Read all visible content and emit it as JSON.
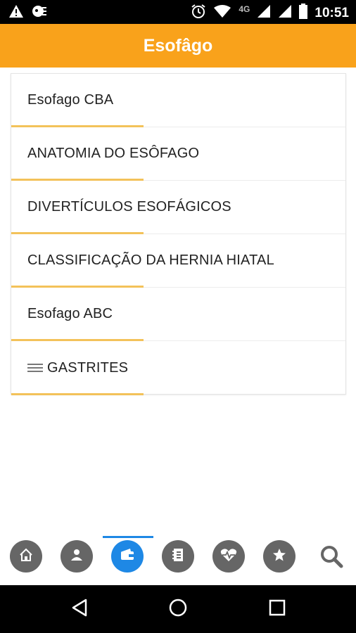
{
  "status_bar": {
    "time": "10:51",
    "network": "4G",
    "icons": [
      "warning-icon",
      "notification-icon",
      "alarm-icon",
      "wifi-icon",
      "signal-icon",
      "battery-icon"
    ]
  },
  "app_bar": {
    "title": "Esofâgo"
  },
  "list": {
    "items": [
      {
        "label": "Esofago CBA",
        "icon": null
      },
      {
        "label": "ANATOMIA DO ESÔFAGO",
        "icon": null
      },
      {
        "label": "DIVERTÍCULOS ESOFÁGICOS",
        "icon": null
      },
      {
        "label": "CLASSIFICAÇÃO DA HERNIA HIATAL",
        "icon": null
      },
      {
        "label": "Esofago ABC",
        "icon": null
      },
      {
        "label": "GASTRITES",
        "icon": "menu-lines-icon"
      }
    ]
  },
  "bottom_nav": {
    "items": [
      {
        "name": "home",
        "icon": "home-icon",
        "active": false
      },
      {
        "name": "profile",
        "icon": "person-icon",
        "active": false
      },
      {
        "name": "wallet",
        "icon": "wallet-icon",
        "active": true
      },
      {
        "name": "notes",
        "icon": "notebook-icon",
        "active": false
      },
      {
        "name": "health",
        "icon": "heartbeat-icon",
        "active": false
      },
      {
        "name": "favorites",
        "icon": "star-icon",
        "active": false
      },
      {
        "name": "search",
        "icon": "search-icon",
        "active": false
      }
    ]
  },
  "system_nav": {
    "icons": [
      "back-icon",
      "home-circle-icon",
      "recents-icon"
    ]
  },
  "colors": {
    "app_bar": "#f9a21b",
    "accent_line": "#f3c25a",
    "nav_active": "#1e88e5",
    "nav_inactive": "#666666"
  }
}
